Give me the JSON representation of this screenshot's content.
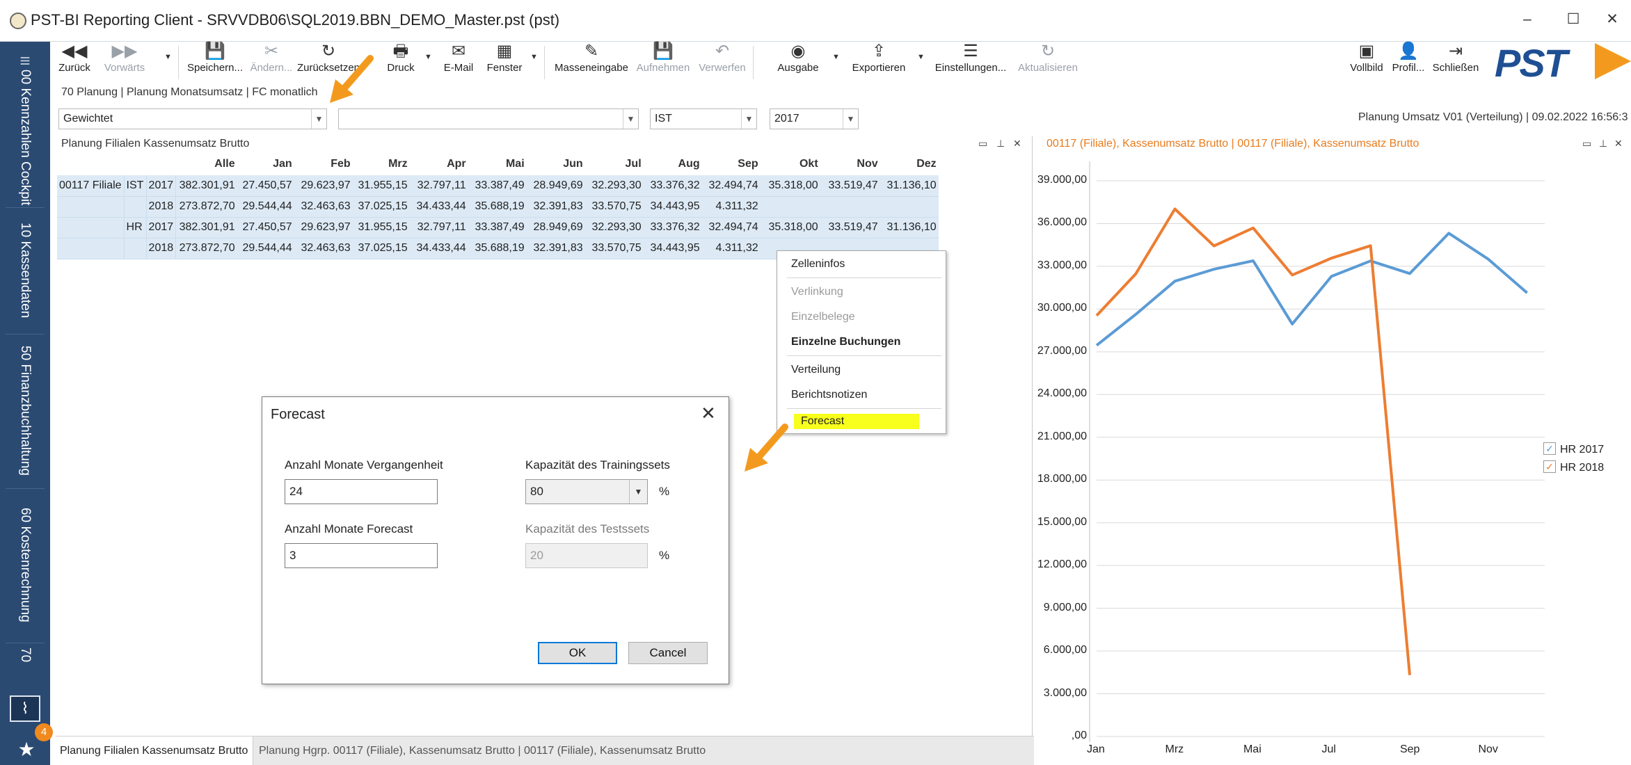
{
  "window": {
    "title": "PST-BI Reporting Client - SRVVDB06\\SQL2019.BBN_DEMO_Master.pst (pst)",
    "minimize": "–",
    "maximize": "☐",
    "close": "✕"
  },
  "nav": {
    "tabs": [
      "00 Kennzahlen Cockpit",
      "10 Kassendaten",
      "50 Finanzbuchhaltung",
      "60 Kostenrechnung",
      "70"
    ],
    "notification_count": "4"
  },
  "ribbon": {
    "back": "Zurück",
    "forward": "Vorwärts",
    "save": "Speichern...",
    "change": "Ändern...",
    "reset": "Zurücksetzen",
    "print": "Druck",
    "email": "E-Mail",
    "window": "Fenster",
    "mass_input": "Masseneingabe",
    "record": "Aufnehmen",
    "discard": "Verwerfen",
    "output": "Ausgabe",
    "export": "Exportieren",
    "settings": "Einstellungen...",
    "refresh": "Aktualisieren",
    "fullscreen": "Vollbild",
    "profile": "Profil...",
    "close": "Schließen",
    "logo": "PST"
  },
  "breadcrumb": "70 Planung | Planung Monatsumsatz | FC monatlich",
  "filters": {
    "weighting": "Gewichtet",
    "empty": "",
    "type": "IST",
    "year": "2017"
  },
  "report_info": "Planung Umsatz V01 (Verteilung) | 09.02.2022 16:56:3",
  "left_panel": {
    "title": "Planung Filialen  Kassenumsatz Brutto",
    "columns": [
      "Alle",
      "Jan",
      "Feb",
      "Mrz",
      "Apr",
      "Mai",
      "Jun",
      "Jul",
      "Aug",
      "Sep",
      "Okt",
      "Nov",
      "Dez"
    ],
    "rows": [
      {
        "branch": "00117 Filiale",
        "type": "IST",
        "year": "2017",
        "values": [
          "382.301,91",
          "27.450,57",
          "29.623,97",
          "31.955,15",
          "32.797,11",
          "33.387,49",
          "28.949,69",
          "32.293,30",
          "33.376,32",
          "32.494,74",
          "35.318,00",
          "33.519,47",
          "31.136,10"
        ]
      },
      {
        "branch": "",
        "type": "",
        "year": "2018",
        "values": [
          "273.872,70",
          "29.544,44",
          "32.463,63",
          "37.025,15",
          "34.433,44",
          "35.688,19",
          "32.391,83",
          "33.570,75",
          "34.443,95",
          "4.311,32",
          "",
          "",
          ""
        ]
      },
      {
        "branch": "",
        "type": "HR",
        "year": "2017",
        "values": [
          "382.301,91",
          "27.450,57",
          "29.623,97",
          "31.955,15",
          "32.797,11",
          "33.387,49",
          "28.949,69",
          "32.293,30",
          "33.376,32",
          "32.494,74",
          "35.318,00",
          "33.519,47",
          "31.136,10"
        ]
      },
      {
        "branch": "",
        "type": "",
        "year": "2018",
        "values": [
          "273.872,70",
          "29.544,44",
          "32.463,63",
          "37.025,15",
          "34.433,44",
          "35.688,19",
          "32.391,83",
          "33.570,75",
          "34.443,95",
          "4.311,32",
          "",
          "",
          ""
        ]
      }
    ]
  },
  "context_menu": {
    "items": [
      "Zelleninfos",
      "Verlinkung",
      "Einzelbelege",
      "Einzelne Buchungen",
      "Verteilung",
      "Berichtsnotizen",
      "Forecast"
    ]
  },
  "dialog": {
    "title": "Forecast",
    "months_past_label": "Anzahl Monate Vergangenheit",
    "months_past_value": "24",
    "months_forecast_label": "Anzahl Monate Forecast",
    "months_forecast_value": "3",
    "training_label": "Kapazität des Trainingssets",
    "training_value": "80",
    "test_label": "Kapazität des Testssets",
    "test_value": "20",
    "percent": "%",
    "ok": "OK",
    "cancel": "Cancel"
  },
  "bottom_tabs": {
    "tab1": "Planung Filialen  Kassenumsatz Brutto",
    "tab2": "Planung Hgrp. 00117 (Filiale), Kassenumsatz Brutto  |  00117 (Filiale), Kassenumsatz Brutto"
  },
  "right_panel": {
    "title": "00117 (Filiale), Kassenumsatz Brutto  |  00117 (Filiale), Kassenumsatz Brutto"
  },
  "colors": {
    "series_2017": "#5b9bd5",
    "series_2018": "#ed7d31",
    "nav_bg": "#2a4a72",
    "highlight": "#f8ff1c",
    "arrow": "#f39a1e"
  },
  "chart_data": {
    "type": "line",
    "x": [
      "Jan",
      "Feb",
      "Mrz",
      "Apr",
      "Mai",
      "Jun",
      "Jul",
      "Aug",
      "Sep",
      "Okt",
      "Nov",
      "Dez"
    ],
    "x_tick_labels": [
      "Jan",
      "Mrz",
      "Mai",
      "Jul",
      "Sep",
      "Nov"
    ],
    "y_tick_labels": [
      ",00",
      "3.000,00",
      "6.000,00",
      "9.000,00",
      "12.000,00",
      "15.000,00",
      "18.000,00",
      "21.000,00",
      "24.000,00",
      "27.000,00",
      "30.000,00",
      "33.000,00",
      "36.000,00",
      "39.000,00"
    ],
    "ylim": [
      0,
      39000
    ],
    "grid": true,
    "legend_position": "right",
    "series": [
      {
        "name": "HR 2017",
        "values": [
          27450.57,
          29623.97,
          31955.15,
          32797.11,
          33387.49,
          28949.69,
          32293.3,
          33376.32,
          32494.74,
          35318.0,
          33519.47,
          31136.1
        ]
      },
      {
        "name": "HR 2018",
        "values": [
          29544.44,
          32463.63,
          37025.15,
          34433.44,
          35688.19,
          32391.83,
          33570.75,
          34443.95,
          4311.32,
          null,
          null,
          null
        ]
      }
    ]
  }
}
